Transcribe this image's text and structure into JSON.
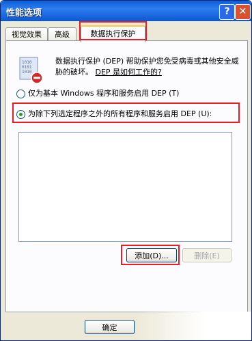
{
  "window": {
    "title": "性能选项",
    "help_glyph": "?",
    "close_glyph": "✕"
  },
  "tabs": [
    {
      "label": "视觉效果",
      "active": false
    },
    {
      "label": "高级",
      "active": false
    },
    {
      "label": "数据执行保护",
      "active": true
    }
  ],
  "dep": {
    "description": "数据执行保护 (DEP) 帮助保护您免受病毒或其他安全威胁的破坏。",
    "link": "DEP 是如何工作的?",
    "option1": "仅为基本 Windows 程序和服务启用 DEP (T)",
    "option2": "为除下列选定程序之外的所有程序和服务启用 DEP (U):",
    "selected_option": 2
  },
  "buttons": {
    "add": "添加(D)...",
    "remove": "删除(E)",
    "ok": "确定"
  },
  "colors": {
    "highlight": "#ec1b24",
    "title_bar": "#0a5fd8"
  },
  "watermark": ""
}
